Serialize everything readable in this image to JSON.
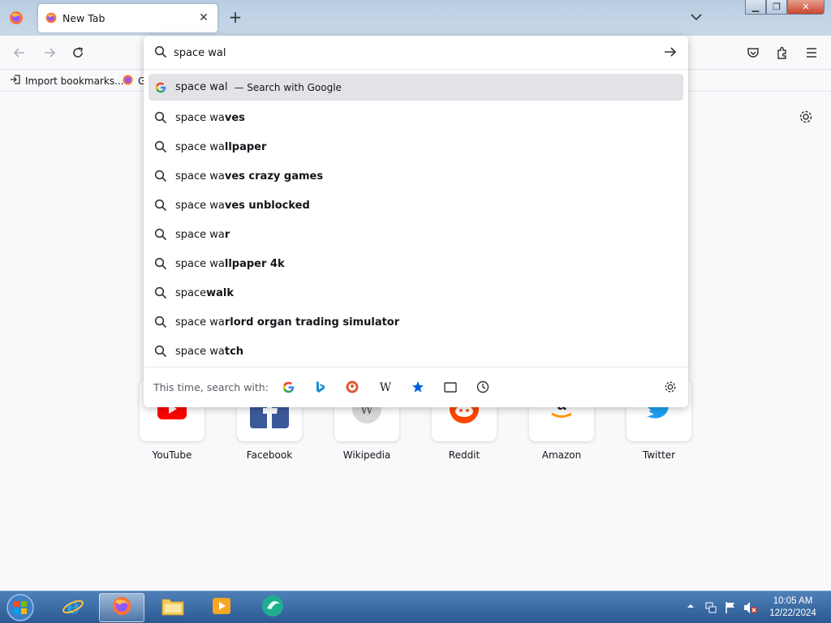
{
  "tab": {
    "title": "New Tab"
  },
  "bookmarks": {
    "import_label": "Import bookmarks...",
    "second_label": "G"
  },
  "urlbar": {
    "value": "space wal",
    "selected": {
      "typed": "space wal",
      "action": "— Search with Google"
    },
    "suggestions": [
      {
        "typed": "space wa",
        "rest": "ves"
      },
      {
        "typed": "space wa",
        "rest": "llpaper"
      },
      {
        "typed": "space wa",
        "rest": "ves crazy games"
      },
      {
        "typed": "space wa",
        "rest": "ves unblocked"
      },
      {
        "typed": "space wa",
        "rest": "r"
      },
      {
        "typed": "space wa",
        "rest": "llpaper 4k"
      },
      {
        "typed": "space",
        "rest": "walk"
      },
      {
        "typed": "space wa",
        "rest": "rlord organ trading simulator"
      },
      {
        "typed": "space wa",
        "rest": "tch"
      }
    ],
    "oneoff_label": "This time, search with:",
    "engines": [
      "google-icon",
      "bing-icon",
      "duckduckgo-icon",
      "wikipedia-icon",
      "bookmarks-icon",
      "tabs-icon",
      "history-icon"
    ]
  },
  "top_sites": [
    {
      "label": "YouTube",
      "icon": "youtube-icon"
    },
    {
      "label": "Facebook",
      "icon": "facebook-icon"
    },
    {
      "label": "Wikipedia",
      "icon": "wikipedia-icon"
    },
    {
      "label": "Reddit",
      "icon": "reddit-icon"
    },
    {
      "label": "Amazon",
      "icon": "amazon-icon"
    },
    {
      "label": "Twitter",
      "icon": "twitter-icon"
    }
  ],
  "taskbar": {
    "time": "10:05 AM",
    "date": "12/22/2024"
  },
  "colors": {
    "accent": "#0060df",
    "taskbar": "#2b5a93",
    "selected_row": "#e3e3e7"
  }
}
